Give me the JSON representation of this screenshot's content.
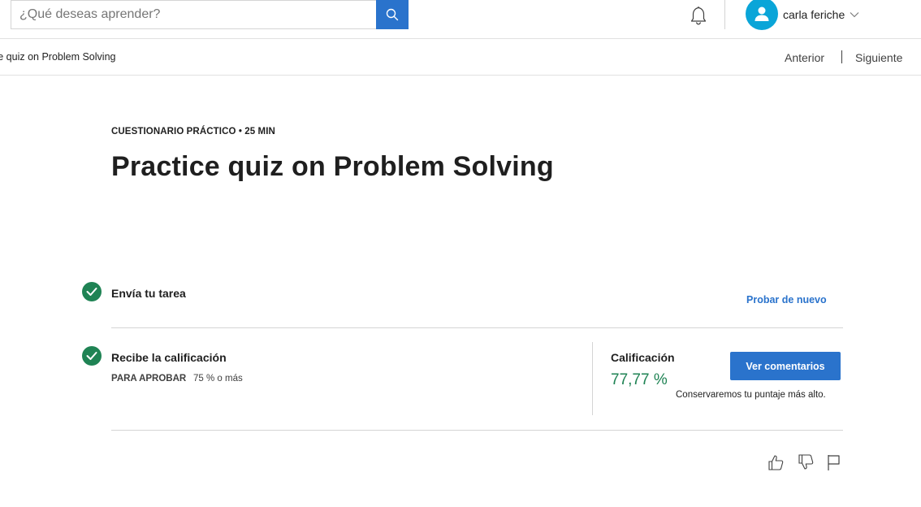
{
  "search": {
    "placeholder": "¿Qué deseas aprender?",
    "button_icon": "search-icon"
  },
  "header": {
    "notifications_icon": "bell-icon",
    "user_name": "carla feriche",
    "avatar_icon": "user-avatar-icon",
    "menu_icon": "chevron-down-icon"
  },
  "breadcrumb": {
    "text": "ce quiz on Problem Solving",
    "prev_label": "Anterior",
    "next_label": "Siguiente"
  },
  "quiz": {
    "eyebrow": "CUESTIONARIO PRÁCTICO • 25 MIN",
    "title": "Practice quiz on Problem Solving"
  },
  "steps": {
    "submit": {
      "title": "Envía tu tarea",
      "retry_label": "Probar de nuevo"
    },
    "grade": {
      "title": "Recibe la calificación",
      "pass_label": "PARA APROBAR",
      "pass_value": "75 % o más",
      "grade_label": "Calificación",
      "grade_value": "77,77 %",
      "feedback_button": "Ver comentarios",
      "keep_note": "Conservaremos tu puntaje más alto."
    }
  },
  "feedback_icons": [
    "thumbs-up-icon",
    "thumbs-down-icon",
    "flag-icon"
  ],
  "colors": {
    "accent": "#2a73cc",
    "success": "#1f8354",
    "avatar": "#0aa5d8"
  }
}
